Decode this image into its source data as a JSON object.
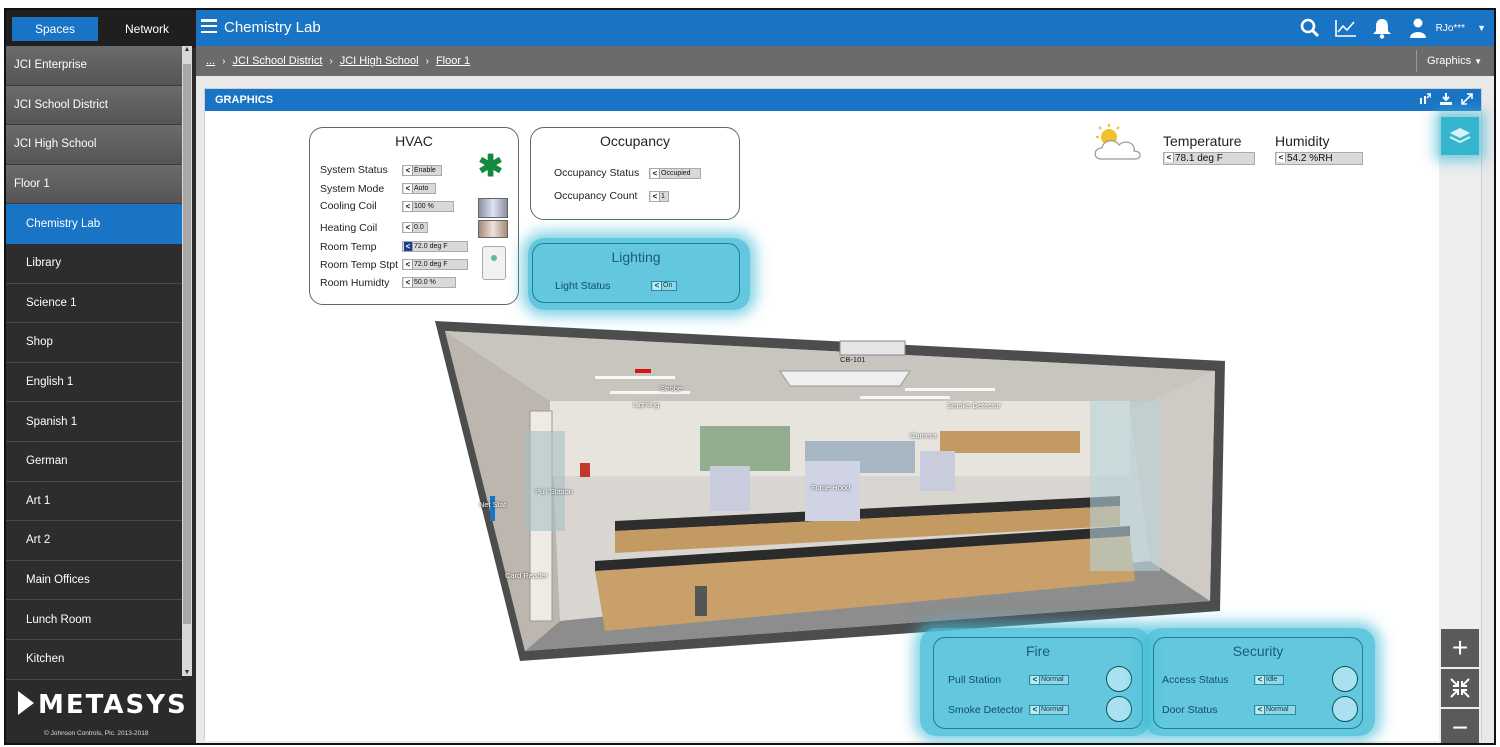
{
  "sidebar": {
    "tabs": [
      {
        "label": "Spaces"
      },
      {
        "label": "Network"
      }
    ],
    "items": [
      {
        "label": "JCI Enterprise"
      },
      {
        "label": "JCI School District"
      },
      {
        "label": "JCI High School"
      },
      {
        "label": "Floor 1"
      },
      {
        "label": "Chemistry Lab"
      },
      {
        "label": "Library"
      },
      {
        "label": "Science 1"
      },
      {
        "label": "Shop"
      },
      {
        "label": "English 1"
      },
      {
        "label": "Spanish 1"
      },
      {
        "label": "German"
      },
      {
        "label": "Art 1"
      },
      {
        "label": "Art 2"
      },
      {
        "label": "Main Offices"
      },
      {
        "label": "Lunch Room"
      },
      {
        "label": "Kitchen"
      }
    ],
    "brand": "METASYS",
    "copyright": "© Johnson Controls, Plc. 2013-2018"
  },
  "topbar": {
    "title": "Chemistry Lab",
    "user": "RJo***",
    "icons": [
      "search-icon",
      "trend-icon",
      "bell-icon",
      "user-icon"
    ],
    "accent": "#1a74c6"
  },
  "breadcrumb": {
    "ellipsis": "...",
    "items": [
      {
        "label": "JCI School District"
      },
      {
        "label": "JCI High School"
      },
      {
        "label": "Floor 1"
      }
    ],
    "view_menu": "Graphics"
  },
  "panel": {
    "title": "GRAPHICS"
  },
  "hvac": {
    "title": "HVAC",
    "rows": [
      {
        "label": "System Status",
        "value": "Enable"
      },
      {
        "label": "System Mode",
        "value": "Auto"
      },
      {
        "label": "Cooling Coil",
        "value": "100  %"
      },
      {
        "label": "Heating Coil",
        "value": "0.0"
      },
      {
        "label": "Room Temp",
        "value": "72.0  deg F"
      },
      {
        "label": "Room Temp Stpt",
        "value": "72.0  deg F"
      },
      {
        "label": "Room Humidty",
        "value": "50.0  %"
      }
    ]
  },
  "occupancy": {
    "title": "Occupancy",
    "rows": [
      {
        "label": "Occupancy Status",
        "value": "Occupied"
      },
      {
        "label": "Occupancy Count",
        "value": "1"
      }
    ]
  },
  "lighting": {
    "title": "Lighting",
    "rows": [
      {
        "label": "Light Status",
        "value": "On"
      }
    ]
  },
  "weather": {
    "temperature_label": "Temperature",
    "temperature_value": "78.1  deg F",
    "humidity_label": "Humidity",
    "humidity_value": "54.2  %RH"
  },
  "fire": {
    "title": "Fire",
    "rows": [
      {
        "label": "Pull Station",
        "value": "Normal"
      },
      {
        "label": "Smoke Detector",
        "value": "Normal"
      }
    ]
  },
  "security": {
    "title": "Security",
    "rows": [
      {
        "label": "Access Status",
        "value": "Idle"
      },
      {
        "label": "Door Status",
        "value": "Normal"
      }
    ]
  },
  "room_labels": {
    "cb": "CB-101",
    "strobe": "Strobe",
    "lighting": "Lighting",
    "smoke": "Smoke Detector",
    "camera": "Camera",
    "pull": "Pull Station",
    "fume": "Fume Hood",
    "netstat": "Net Stat",
    "card": "Card Reader"
  },
  "zoom": {
    "in": "+",
    "out": "−"
  }
}
